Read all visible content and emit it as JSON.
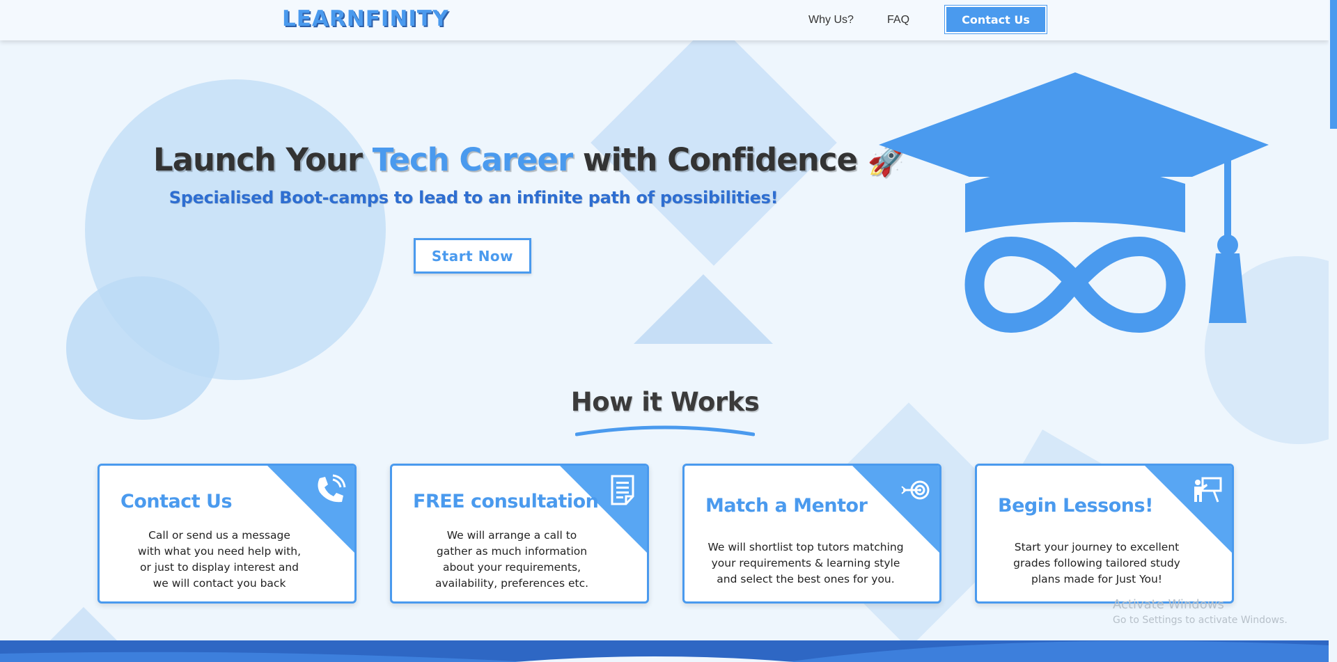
{
  "nav": {
    "logo": "LEARNFINITY",
    "links": [
      "Why Us?",
      "FAQ"
    ],
    "contact_button": "Contact Us"
  },
  "hero": {
    "title_part1": "Launch Your ",
    "title_accent": "Tech Career",
    "title_part2": " with Confidence ",
    "title_emoji": "🚀",
    "subtitle": "Specialised Boot-camps to lead to an infinite path of possibilities!",
    "start_button": "Start Now"
  },
  "how_it_works": {
    "title": "How it Works",
    "cards": [
      {
        "title": "Contact Us",
        "icon": "phone-icon",
        "lines": [
          "Call or send us a message",
          "with what you need help with,",
          "or just to display interest and",
          "we will contact you back"
        ]
      },
      {
        "title": "FREE consultation",
        "icon": "document-icon",
        "lines": [
          "We will arrange a call to",
          "gather as much information",
          "about your requirements,",
          "availability, preferences etc."
        ]
      },
      {
        "title": "Match a Mentor",
        "icon": "target-icon",
        "lines": [
          "We will shortlist top tutors matching",
          "your requirements & learning style",
          "and select the best ones for you."
        ]
      },
      {
        "title": "Begin Lessons!",
        "icon": "teacher-board-icon",
        "lines": [
          "Start your journey to excellent",
          "grades following tailored study",
          "plans made for Just You!"
        ]
      }
    ]
  },
  "watermark": {
    "line1": "Activate Windows",
    "line2": "Go to Settings to activate Windows."
  },
  "colors": {
    "primary": "#4a9aee",
    "dark_blue": "#2e6ed1",
    "background": "#eef6fd",
    "text": "#333333"
  }
}
